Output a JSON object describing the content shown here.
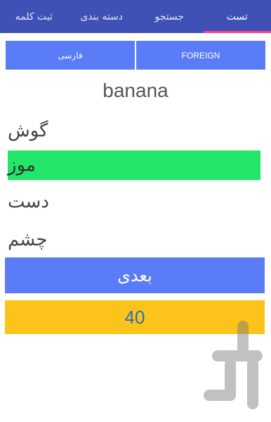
{
  "tabs": [
    {
      "label": "تست",
      "active": true
    },
    {
      "label": "جستجو",
      "active": false
    },
    {
      "label": "دسته بندی",
      "active": false
    },
    {
      "label": "ثبت کلمه",
      "active": false
    }
  ],
  "languages": {
    "foreign": "FOREIGN",
    "farsi": "فارسی"
  },
  "question_word": "banana",
  "options": [
    "گوش",
    "موز",
    "دست",
    "چشم"
  ],
  "selected_option_index": 1,
  "next_label": "بعدی",
  "score": "40",
  "colors": {
    "tabbar": "#3f51b5",
    "tab_indicator": "#ff4081",
    "button_blue": "#5b7cf7",
    "correct_green": "#22e66a",
    "score_yellow": "#fcc31a",
    "score_text": "#2c6fbd"
  },
  "watermark_icon": "bazaar-logo-icon"
}
